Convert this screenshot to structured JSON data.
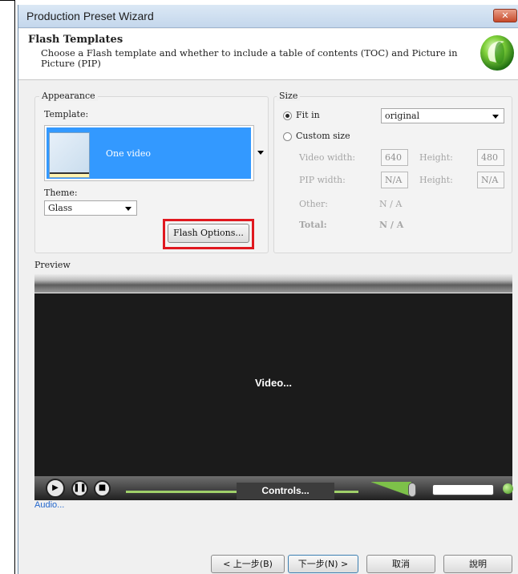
{
  "window": {
    "title": "Production Preset Wizard",
    "close_glyph": "✕"
  },
  "header": {
    "title": "Flash Templates",
    "description": "Choose a Flash template and whether to include a table of contents (TOC) and Picture in Picture (PIP)"
  },
  "appearance": {
    "group_label": "Appearance",
    "template_label": "Template:",
    "template_selected": "One video",
    "theme_label": "Theme:",
    "theme_value": "Glass",
    "flash_options_label": "Flash Options..."
  },
  "size": {
    "group_label": "Size",
    "fit_in_label": "Fit in",
    "fit_in_value": "original",
    "custom_size_label": "Custom size",
    "selected_option": "Fit in",
    "video_width_label": "Video width:",
    "video_width_value": "640",
    "video_height_label": "Height:",
    "video_height_value": "480",
    "pip_width_label": "PIP width:",
    "pip_width_value": "N/A",
    "pip_height_label": "Height:",
    "pip_height_value": "N/A",
    "other_label": "Other:",
    "other_value": "N / A",
    "total_label": "Total:",
    "total_value": "N / A"
  },
  "preview": {
    "label": "Preview",
    "video_text": "Video...",
    "controls_text": "Controls...",
    "audio_text": "Audio..."
  },
  "footer": {
    "back_label": "< 上一步(B)",
    "next_label": "下一步(N) >",
    "cancel_label": "取消",
    "help_label": "說明"
  },
  "colors": {
    "accent_highlight": "#e0181f",
    "selection_blue": "#3399ff",
    "video_bg": "#1b1b1b",
    "seek_green": "#9fd06a"
  },
  "icons": {
    "logo": "camtasia-green-ball-logo",
    "close": "close-icon",
    "play": "play-icon",
    "pause": "pause-icon",
    "stop": "stop-icon"
  }
}
